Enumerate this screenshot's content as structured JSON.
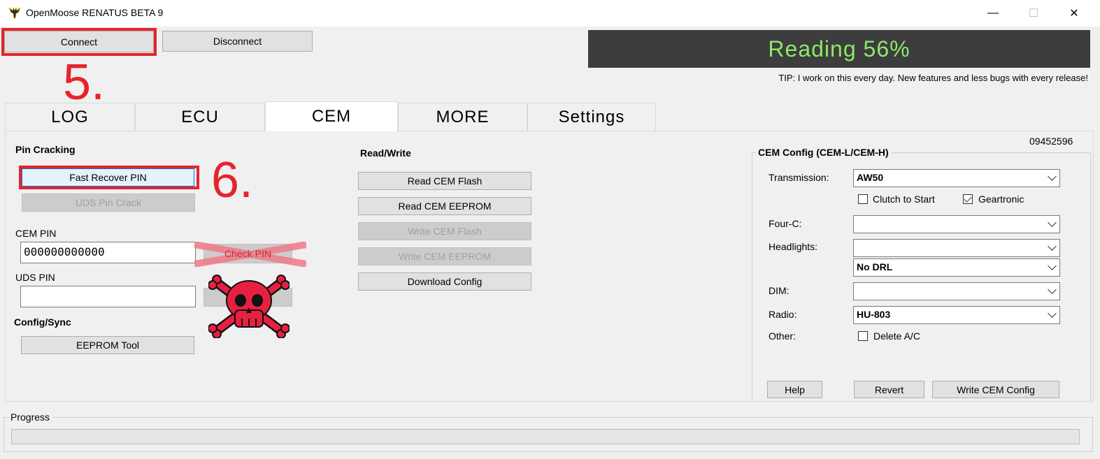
{
  "window": {
    "title": "OpenMoose RENATUS BETA 9",
    "controls": {
      "minimize": "—",
      "maximize": "☐",
      "close": "✕"
    }
  },
  "toolbar": {
    "connect_label": "Connect",
    "disconnect_label": "Disconnect"
  },
  "status": {
    "text": "Reading 56%",
    "color": "#8de86b"
  },
  "tip": "TIP: I work on this every day. New features and less bugs with every release!",
  "annotations": {
    "step5": "5.",
    "step6": "6.",
    "color": "#e5242c"
  },
  "tabs": [
    {
      "label": "LOG"
    },
    {
      "label": "ECU"
    },
    {
      "label": "CEM",
      "active": true
    },
    {
      "label": "MORE"
    },
    {
      "label": "Settings"
    }
  ],
  "cem": {
    "part_number": "09452596",
    "pin_cracking": {
      "heading": "Pin Cracking",
      "fast_recover_label": "Fast Recover PIN",
      "uds_pin_crack_label": "UDS Pin Crack"
    },
    "cem_pin": {
      "label": "CEM PIN",
      "value": "000000000000",
      "check_label": "Check PIN"
    },
    "uds_pin": {
      "label": "UDS PIN",
      "value": ""
    },
    "config_sync": {
      "heading": "Config/Sync",
      "eeprom_tool_label": "EEPROM Tool"
    },
    "read_write": {
      "heading": "Read/Write",
      "buttons": [
        "Read CEM Flash",
        "Read CEM EEPROM",
        "Write CEM Flash",
        "Write CEM EEPROM",
        "Download Config"
      ]
    },
    "config": {
      "title": "CEM Config (CEM-L/CEM-H)",
      "transmission": {
        "label": "Transmission:",
        "value": "AW50"
      },
      "clutch_to_start": {
        "label": "Clutch to Start",
        "checked": false
      },
      "geartronic": {
        "label": "Geartronic",
        "checked": true
      },
      "four_c": {
        "label": "Four-C:",
        "value": ""
      },
      "headlights": {
        "label": "Headlights:",
        "value": "",
        "drl_value": "No DRL"
      },
      "dim": {
        "label": "DIM:",
        "value": ""
      },
      "radio": {
        "label": "Radio:",
        "value": "HU-803"
      },
      "other": {
        "label": "Other:"
      },
      "delete_ac": {
        "label": "Delete A/C",
        "checked": false
      },
      "help_label": "Help",
      "revert_label": "Revert",
      "write_label": "Write CEM Config"
    }
  },
  "progress": {
    "label": "Progress",
    "value": 0
  }
}
